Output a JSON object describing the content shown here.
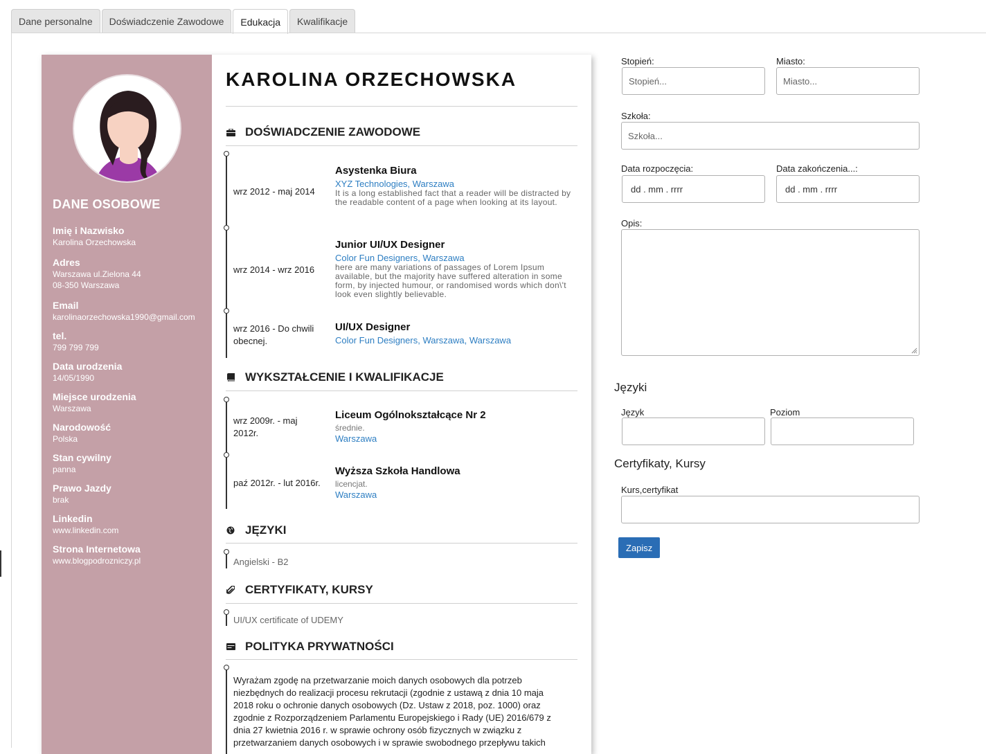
{
  "tabs": [
    {
      "label": "Dane personalne"
    },
    {
      "label": "Doświadczenie Zawodowe"
    },
    {
      "label": "Edukacja"
    },
    {
      "label": "Kwalifikacje"
    }
  ],
  "active_tab": "Edukacja",
  "cv": {
    "name": "KAROLINA ORZECHOWSKA",
    "sidebar": {
      "title": "DANE OSOBOWE",
      "fields": [
        {
          "label": "Imię i Nazwisko",
          "value": "Karolina Orzechowska"
        },
        {
          "label": "Adres",
          "value": "Warszawa ul.Zielona 44",
          "value2": "08-350 Warszawa"
        },
        {
          "label": "Email",
          "value": "karolinaorzechowska1990@gmail.com"
        },
        {
          "label": "tel.",
          "value": "799 799 799"
        },
        {
          "label": "Data urodzenia",
          "value": "14/05/1990"
        },
        {
          "label": "Miejsce urodzenia",
          "value": "Warszawa"
        },
        {
          "label": "Narodowość",
          "value": "Polska"
        },
        {
          "label": "Stan cywilny",
          "value": "panna"
        },
        {
          "label": "Prawo Jazdy",
          "value": "brak"
        },
        {
          "label": "Linkedin",
          "value": "www.linkedin.com"
        },
        {
          "label": "Strona Internetowa",
          "value": "www.blogpodrozniczy.pl"
        }
      ]
    },
    "experience": {
      "title": "DOŚWIADCZENIE ZAWODOWE",
      "items": [
        {
          "date": "wrz 2012 - maj 2014",
          "title": "Asystenka Biura",
          "company": "XYZ Technologies, Warszawa",
          "desc": "It is a long established fact that a reader will be distracted by the readable content of a page when looking at its layout."
        },
        {
          "date": "wrz 2014 - wrz 2016",
          "title": "Junior UI/UX Designer",
          "company": "Color Fun Designers, Warszawa",
          "desc": "here are many variations of passages of Lorem Ipsum available, but the majority have suffered alteration in some form, by injected humour, or randomised words which don\\'t look even slightly believable."
        },
        {
          "date": "wrz 2016 - Do chwili obecnej.",
          "title": "UI/UX Designer",
          "company": "Color Fun Designers, Warszawa, Warszawa",
          "desc": ""
        }
      ]
    },
    "education": {
      "title": "WYKSZTAŁCENIE I KWALIFIKACJE",
      "items": [
        {
          "date": "wrz 2009r. - maj 2012r.",
          "title": "Liceum Ogólnokształcące Nr 2",
          "level": "średnie.",
          "city": "Warszawa"
        },
        {
          "date": "paź 2012r. - lut 2016r.",
          "title": "Wyższa Szkoła Handlowa",
          "level": "licencjat.",
          "city": "Warszawa"
        }
      ]
    },
    "languages": {
      "title": "JĘZYKI",
      "items": [
        "Angielski - B2"
      ]
    },
    "certificates": {
      "title": "CERTYFIKATY, KURSY",
      "items": [
        "UI/UX certificate of UDEMY"
      ]
    },
    "privacy": {
      "title": "POLITYKA PRYWATNOŚCI",
      "text": "Wyrażam zgodę na przetwarzanie moich danych osobowych dla potrzeb niezbędnych do realizacji procesu rekrutacji (zgodnie z ustawą z dnia 10 maja 2018 roku o ochronie danych osobowych (Dz. Ustaw z 2018, poz. 1000) oraz zgodnie z Rozporządzeniem Parlamentu Europejskiego i Rady (UE) 2016/679 z dnia 27 kwietnia 2016 r. w sprawie ochrony osób fizycznych w związku z przetwarzaniem danych osobowych i w sprawie swobodnego przepływu takich"
    }
  },
  "form": {
    "degree": {
      "label": "Stopień:",
      "placeholder": "Stopień..."
    },
    "city": {
      "label": "Miasto:",
      "placeholder": "Miasto..."
    },
    "school": {
      "label": "Szkoła:",
      "placeholder": "Szkoła..."
    },
    "start_date": {
      "label": "Data rozpoczęcia:",
      "placeholder": "dd . mm . rrrr"
    },
    "end_date": {
      "label": "Data zakończenia...:",
      "placeholder": "dd . mm . rrrr"
    },
    "description": {
      "label": "Opis:"
    },
    "languages_title": "Języki",
    "language": {
      "label": "Język"
    },
    "level": {
      "label": "Poziom"
    },
    "certificates_title": "Certyfikaty, Kursy",
    "course": {
      "label": "Kurs,certyfikat"
    },
    "save_label": "Zapisz"
  }
}
